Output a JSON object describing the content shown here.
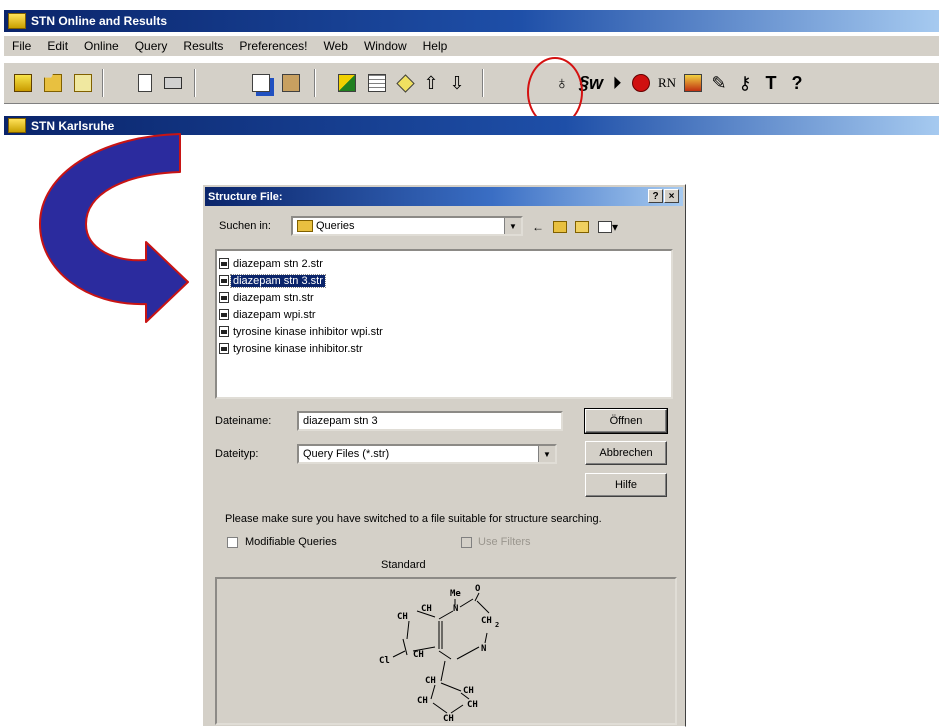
{
  "app": {
    "title": "STN Online and Results",
    "menu": [
      "File",
      "Edit",
      "Online",
      "Query",
      "Results",
      "Preferences!",
      "Web",
      "Window",
      "Help"
    ],
    "subwindow_title": "STN Karlsruhe"
  },
  "toolbar_icons": [
    "open-folder-icon",
    "folder-icon",
    "edit-icon",
    "document-icon",
    "print-icon",
    "copy-icon",
    "paste-icon",
    "connect-icon",
    "table-icon",
    "tag-icon",
    "upload-icon",
    "download-icon",
    "structure-search-icon",
    "signature-icon",
    "play-icon",
    "stop-icon",
    "rn-icon",
    "book-icon",
    "pen-icon",
    "key-icon",
    "tool-icon",
    "help-icon"
  ],
  "toolbar_labels": {
    "rn": "RN",
    "help": "?"
  },
  "dialog": {
    "title": "Structure File:",
    "title_buttons": [
      "?",
      "×"
    ],
    "look_in_label": "Suchen in:",
    "look_in_value": "Queries",
    "files": [
      {
        "name": "diazepam stn 2.str",
        "selected": false
      },
      {
        "name": "diazepam stn 3.str",
        "selected": true
      },
      {
        "name": "diazepam stn.str",
        "selected": false
      },
      {
        "name": "diazepam wpi.str",
        "selected": false
      },
      {
        "name": "tyrosine kinase inhibitor wpi.str",
        "selected": false
      },
      {
        "name": "tyrosine kinase inhibitor.str",
        "selected": false
      }
    ],
    "filename_label": "Dateiname:",
    "filename_value": "diazepam stn 3",
    "filetype_label": "Dateityp:",
    "filetype_value": "Query Files (*.str)",
    "open_button": "Öffnen",
    "cancel_button": "Abbrechen",
    "help_button": "Hilfe",
    "hint": "Please make sure you have switched to a file suitable for structure searching.",
    "modifiable_label": "Modifiable Queries",
    "filters_label": "Use Filters",
    "preview_label": "Standard",
    "structure_atoms": {
      "me": "Me",
      "o": "O",
      "n1": "N",
      "n2": "N",
      "ch2": "CH",
      "sub2": "2",
      "cl": "Cl",
      "ch_a": "CH",
      "ch_b": "CH",
      "ch_c": "CH",
      "ch_d": "CH",
      "ch_e": "CH",
      "ch_f": "CH",
      "ch_g": "CH",
      "ch_h": "CH"
    }
  },
  "colors": {
    "titlebar": "#0a246a",
    "highlight": "#d41111",
    "arrow": "#2b2b9e",
    "arrow_outline": "#c81414"
  }
}
